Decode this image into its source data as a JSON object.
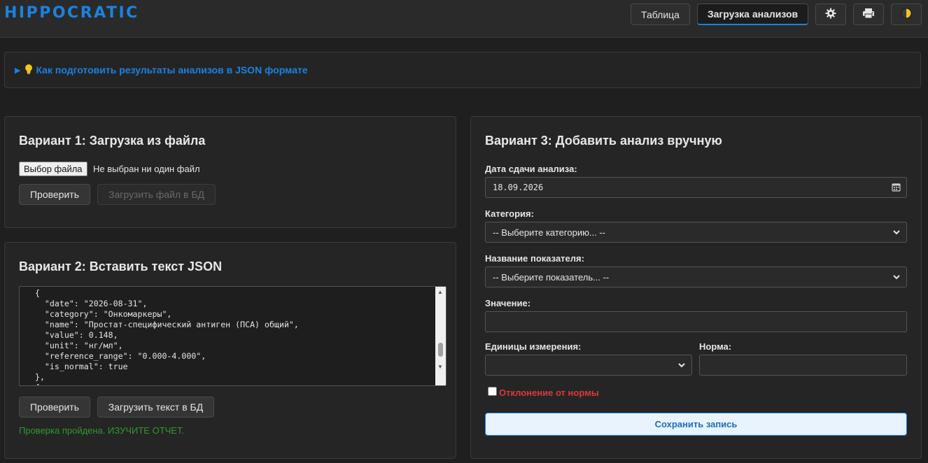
{
  "app": {
    "logo": "HIPPOCRATIC"
  },
  "nav": {
    "table_label": "Таблица",
    "upload_label": "Загрузка анализов"
  },
  "icons": {
    "settings": "gear-icon",
    "print": "printer-icon",
    "theme": "theme-toggle-icon"
  },
  "hint": {
    "text": "Как подготовить результаты анализов в JSON формате"
  },
  "variant1": {
    "title": "Вариант 1: Загрузка из файла",
    "file_button": "Выбор файла",
    "file_status": "Не выбран ни один файл",
    "check_label": "Проверить",
    "upload_label": "Загрузить файл в БД"
  },
  "variant2": {
    "title": "Вариант 2: Вставить текст JSON",
    "json_text": "  {\n    \"date\": \"2026-08-31\",\n    \"category\": \"Онкомаркеры\",\n    \"name\": \"Простат-специфический антиген (ПСА) общий\",\n    \"value\": 0.148,\n    \"unit\": \"нг/мл\",\n    \"reference_range\": \"0.000-4.000\",\n    \"is_normal\": true\n  },\n  {",
    "check_label": "Проверить",
    "upload_label": "Загрузить текст в БД",
    "status": "Проверка пройдена. ИЗУЧИТЕ ОТЧЕТ."
  },
  "variant3": {
    "title": "Вариант 3: Добавить анализ вручную",
    "date_label": "Дата сдачи анализа:",
    "date_value": "18.09.2026",
    "category_label": "Категория:",
    "category_placeholder": "-- Выберите категорию... --",
    "indicator_label": "Название показателя:",
    "indicator_placeholder": "-- Выберите показатель... --",
    "value_label": "Значение:",
    "value_value": "",
    "unit_label": "Единицы измерения:",
    "unit_value": "",
    "norm_label": "Норма:",
    "norm_value": "",
    "deviation_label": "Отклонение от нормы",
    "save_label": "Сохранить запись"
  },
  "colors": {
    "accent": "#1a82e2",
    "success": "#2e9a2e",
    "danger": "#d93a3a"
  }
}
